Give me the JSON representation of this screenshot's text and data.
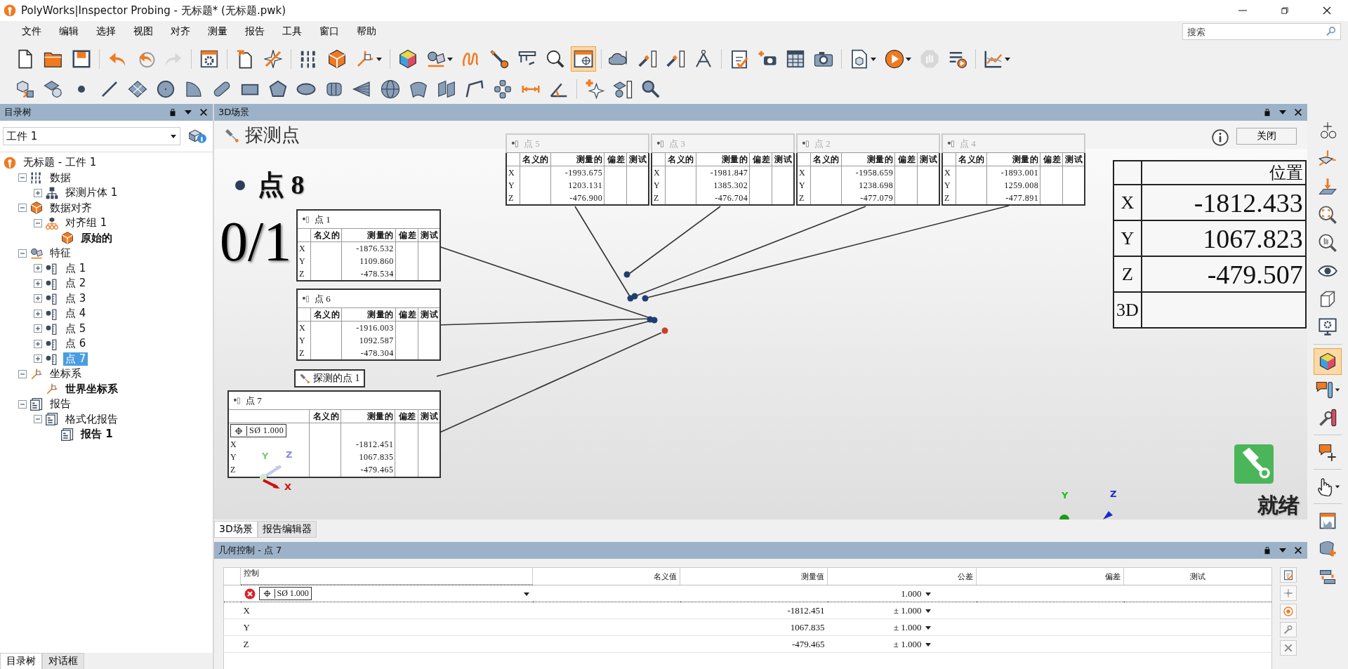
{
  "window": {
    "title": "PolyWorks|Inspector Probing - 无标题* (无标题.pwk)"
  },
  "menu": [
    "文件",
    "编辑",
    "选择",
    "视图",
    "对齐",
    "测量",
    "报告",
    "工具",
    "窗口",
    "帮助"
  ],
  "search": {
    "placeholder": "搜索"
  },
  "toolbar_1": [
    {
      "selected": false,
      "disabled": false
    },
    {
      "selected": false,
      "disabled": false
    },
    {
      "selected": false,
      "disabled": false
    },
    {
      "selected": false,
      "disabled": false
    },
    {
      "selected": false,
      "disabled": false
    },
    {
      "selected": false,
      "disabled": true
    },
    {
      "selected": false,
      "disabled": false
    },
    {
      "selected": false,
      "disabled": false
    },
    {
      "selected": false,
      "disabled": false
    },
    {
      "selected": false,
      "disabled": false
    },
    {
      "selected": false,
      "disabled": false
    },
    {
      "selected": false,
      "disabled": false
    },
    {
      "selected": false,
      "disabled": false
    },
    {
      "selected": false,
      "disabled": false
    },
    {
      "selected": false,
      "disabled": false
    },
    {
      "selected": false,
      "disabled": false
    },
    {
      "selected": false,
      "disabled": false
    },
    {
      "selected": false,
      "disabled": false
    },
    {
      "selected": true,
      "disabled": false
    },
    {
      "selected": false,
      "disabled": false
    },
    {
      "selected": false,
      "disabled": false
    },
    {
      "selected": false,
      "disabled": false
    },
    {
      "selected": false,
      "disabled": false
    },
    {
      "selected": false,
      "disabled": false
    },
    {
      "selected": false,
      "disabled": false
    },
    {
      "selected": false,
      "disabled": false
    },
    {
      "selected": false,
      "disabled": false
    },
    {
      "selected": false,
      "disabled": false
    },
    {
      "selected": false,
      "disabled": false
    },
    {
      "selected": false,
      "disabled": true
    },
    {
      "selected": false,
      "disabled": false
    },
    {
      "selected": false,
      "disabled": false
    }
  ],
  "toolbar_2": [
    {
      "selected": false
    },
    {
      "selected": false
    },
    {
      "selected": false
    },
    {
      "selected": false
    },
    {
      "selected": false
    },
    {
      "selected": false
    },
    {
      "selected": false
    },
    {
      "selected": false
    },
    {
      "selected": false
    },
    {
      "selected": false
    },
    {
      "selected": false
    },
    {
      "selected": false
    },
    {
      "selected": false
    },
    {
      "selected": false
    },
    {
      "selected": false
    },
    {
      "selected": false
    },
    {
      "selected": false
    },
    {
      "selected": false
    },
    {
      "selected": false
    },
    {
      "selected": false
    },
    {
      "selected": false
    },
    {
      "selected": false
    },
    {
      "selected": false
    }
  ],
  "tree_panel": {
    "title": "目录树",
    "workpiece": "工件 1",
    "items": [
      {
        "label": "无标题 - 工件 1",
        "kind": "root",
        "selected": false,
        "active": false,
        "children": [
          {
            "label": "数据",
            "kind": "data",
            "expanded": true,
            "selected": false,
            "active": false,
            "children": [
              {
                "label": "探测片体 1",
                "kind": "scan",
                "expanded": false,
                "selected": false,
                "active": false
              }
            ]
          },
          {
            "label": "数据对齐",
            "kind": "alignment",
            "expanded": true,
            "selected": false,
            "active": false,
            "children": [
              {
                "label": "对齐组 1",
                "kind": "group",
                "expanded": true,
                "selected": false,
                "active": false,
                "children": [
                  {
                    "label": "原始的",
                    "kind": "original",
                    "selected": false,
                    "active": true
                  }
                ]
              }
            ]
          },
          {
            "label": "特征",
            "kind": "features",
            "expanded": true,
            "selected": false,
            "active": false,
            "children": [
              {
                "label": "点 1",
                "kind": "point",
                "expanded": false,
                "selected": false,
                "active": false
              },
              {
                "label": "点 2",
                "kind": "point",
                "expanded": false,
                "selected": false,
                "active": false
              },
              {
                "label": "点 3",
                "kind": "point",
                "expanded": false,
                "selected": false,
                "active": false
              },
              {
                "label": "点 4",
                "kind": "point",
                "expanded": false,
                "selected": false,
                "active": false
              },
              {
                "label": "点 5",
                "kind": "point",
                "expanded": false,
                "selected": false,
                "active": false
              },
              {
                "label": "点 6",
                "kind": "point",
                "expanded": false,
                "selected": false,
                "active": false
              },
              {
                "label": "点 7",
                "kind": "point",
                "expanded": false,
                "selected": true,
                "active": false
              }
            ]
          },
          {
            "label": "坐标系",
            "kind": "coords",
            "expanded": true,
            "selected": false,
            "active": false,
            "children": [
              {
                "label": "世界坐标系",
                "kind": "csys",
                "selected": false,
                "active": true
              }
            ]
          },
          {
            "label": "报告",
            "kind": "report",
            "expanded": true,
            "selected": false,
            "active": false,
            "children": [
              {
                "label": "格式化报告",
                "kind": "report",
                "expanded": true,
                "selected": false,
                "active": false,
                "children": [
                  {
                    "label": "报告 1",
                    "kind": "report",
                    "selected": false,
                    "active": true
                  }
                ]
              }
            ]
          }
        ]
      }
    ]
  },
  "left_tabs": [
    {
      "label": "目录树",
      "selected": true
    },
    {
      "label": "对话框",
      "selected": false
    }
  ],
  "scene": {
    "title": "3D场景",
    "heading": "探测点",
    "close_button": "关闭",
    "current": "点 8",
    "progress": "0/1",
    "callouts": [
      {
        "title": "点 5",
        "faded": true,
        "columns": [
          "名义的",
          "测量的",
          "偏差",
          "测试"
        ],
        "rows": [
          {
            "axis": "X",
            "measured": "-1993.675"
          },
          {
            "axis": "Y",
            "measured": "1203.131"
          },
          {
            "axis": "Z",
            "measured": "-476.900"
          }
        ]
      },
      {
        "title": "点 3",
        "faded": true,
        "columns": [
          "名义的",
          "测量的",
          "偏差",
          "测试"
        ],
        "rows": [
          {
            "axis": "X",
            "measured": "-1981.847"
          },
          {
            "axis": "Y",
            "measured": "1385.302"
          },
          {
            "axis": "Z",
            "measured": "-476.704"
          }
        ]
      },
      {
        "title": "点 2",
        "faded": true,
        "columns": [
          "名义的",
          "测量的",
          "偏差",
          "测试"
        ],
        "rows": [
          {
            "axis": "X",
            "measured": "-1958.659"
          },
          {
            "axis": "Y",
            "measured": "1238.698"
          },
          {
            "axis": "Z",
            "measured": "-477.079"
          }
        ]
      },
      {
        "title": "点 4",
        "faded": true,
        "columns": [
          "名义的",
          "测量的",
          "偏差",
          "测试"
        ],
        "rows": [
          {
            "axis": "X",
            "measured": "-1893.001"
          },
          {
            "axis": "Y",
            "measured": "1259.008"
          },
          {
            "axis": "Z",
            "measured": "-477.891"
          }
        ]
      },
      {
        "title": "点 1",
        "faded": false,
        "columns": [
          "名义的",
          "测量的",
          "偏差",
          "测试"
        ],
        "rows": [
          {
            "axis": "X",
            "measured": "-1876.532"
          },
          {
            "axis": "Y",
            "measured": "1109.860"
          },
          {
            "axis": "Z",
            "measured": "-478.534"
          }
        ]
      },
      {
        "title": "点 6",
        "faded": false,
        "columns": [
          "名义的",
          "测量的",
          "偏差",
          "测试"
        ],
        "rows": [
          {
            "axis": "X",
            "measured": "-1916.003"
          },
          {
            "axis": "Y",
            "measured": "1092.587"
          },
          {
            "axis": "Z",
            "measured": "-478.304"
          }
        ]
      },
      {
        "title": "点 7",
        "faded": false,
        "control": "SØ 1.000",
        "columns": [
          "名义的",
          "测量的",
          "偏差",
          "测试"
        ],
        "rows": [
          {
            "axis": "X",
            "measured": "-1812.451"
          },
          {
            "axis": "Y",
            "measured": "1067.835"
          },
          {
            "axis": "Z",
            "measured": "-479.465"
          }
        ]
      }
    ],
    "probed_label": "探测的点 1",
    "points": [
      {
        "color": "#1f3f6e"
      },
      {
        "color": "#1f3f6e"
      },
      {
        "color": "#1f3f6e"
      },
      {
        "color": "#1f3f6e"
      },
      {
        "color": "#1f3f6e"
      },
      {
        "color": "#1f3f6e"
      },
      {
        "color": "#c8402a"
      }
    ],
    "origin_triad": {
      "x": "X",
      "y": "Y",
      "z": "Z"
    },
    "view_triad": {
      "y": "Y",
      "z": "Z"
    },
    "position": {
      "heading": "位置",
      "rows": [
        {
          "axis": "X",
          "value": "-1812.433"
        },
        {
          "axis": "Y",
          "value": "1067.823"
        },
        {
          "axis": "Z",
          "value": "-479.507"
        },
        {
          "axis": "3D"
        }
      ]
    },
    "status": "就绪"
  },
  "view_tabs": [
    {
      "label": "3D场景",
      "selected": true
    },
    {
      "label": "报告编辑器",
      "selected": false
    }
  ],
  "geometry_control": {
    "title": "几何控制 - 点 7",
    "columns": [
      "控制",
      "名义值",
      "测量值",
      "公差",
      "偏差",
      "测试"
    ],
    "rows": [
      {
        "kind": "control",
        "failed": true,
        "control": "SØ 1.000",
        "tolerance": "1.000"
      },
      {
        "kind": "axis",
        "label": "X",
        "measured": "-1812.451",
        "tolerance": "± 1.000"
      },
      {
        "kind": "axis",
        "label": "Y",
        "measured": "1067.835",
        "tolerance": "± 1.000"
      },
      {
        "kind": "axis",
        "label": "Z",
        "measured": "-479.465",
        "tolerance": "± 1.000"
      }
    ]
  },
  "side_toolbar": [
    {
      "selected": false
    },
    {
      "selected": false
    },
    {
      "selected": false
    },
    {
      "selected": false
    },
    {
      "selected": false
    },
    {
      "selected": false
    },
    {
      "selected": false
    },
    {
      "selected": false
    },
    {
      "selected": true
    },
    {
      "selected": false
    },
    {
      "selected": false
    },
    {
      "selected": false
    },
    {
      "selected": false
    },
    {
      "selected": false
    },
    {
      "selected": false
    },
    {
      "selected": false
    }
  ]
}
